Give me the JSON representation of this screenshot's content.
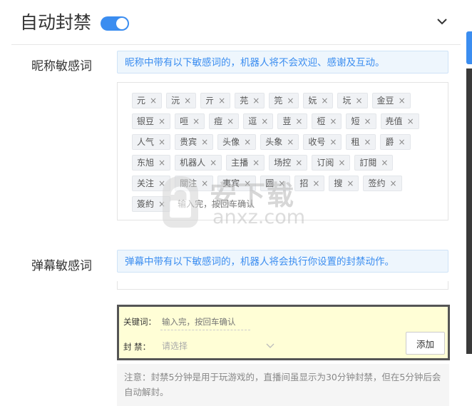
{
  "header": {
    "title": "自动封禁",
    "toggle_on": true,
    "accent_color": "#3b8df0"
  },
  "nickname": {
    "label": "昵称敏感词",
    "note": "昵称中带有以下敏感词的，机器人将不会欢迎、感谢及互动。",
    "tags": [
      "元",
      "沅",
      "亓",
      "芫",
      "笎",
      "妧",
      "坃",
      "金豆",
      "银豆",
      "咺",
      "痘",
      "逗",
      "荳",
      "梪",
      "短",
      "尭值",
      "人气",
      "贵宾",
      "头像",
      "头象",
      "收号",
      "租",
      "爵",
      "东旭",
      "机器人",
      "主播",
      "场控",
      "订阅",
      "訂閱",
      "关注",
      "關注",
      "夷宾",
      "圆",
      "招",
      "搜",
      "签约",
      "簽約"
    ],
    "input_placeholder": "输入完，按回车确认"
  },
  "barrage": {
    "label": "弹幕敏感词",
    "note": "弹幕中带有以下敏感词的，机器人将会执行你设置的封禁动作。"
  },
  "form": {
    "keyword_label": "关键词：",
    "keyword_placeholder": "输入完，按回车确认",
    "ban_label": "封 禁：",
    "ban_placeholder": "请选择",
    "add_button": "添加"
  },
  "footnote": "注意：封禁5分钟是用于玩游戏的，直播间虽显示为30分钟封禁，但在5分钟后会自动解封。",
  "watermark": {
    "brand": "安下载",
    "site": "anxz.com"
  }
}
